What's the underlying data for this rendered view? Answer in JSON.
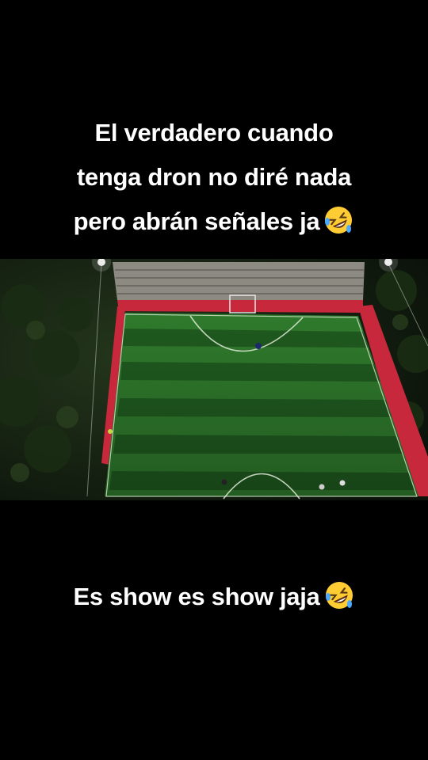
{
  "caption_top": {
    "lines": [
      "El verdadero cuando",
      "tenga dron no diré nada",
      "pero abrán señales ja"
    ],
    "emoji": "rolling-on-floor-laughing-emoji"
  },
  "caption_bottom": {
    "text": "Es show es show jaja",
    "emoji": "rolling-on-floor-laughing-emoji"
  },
  "photo": {
    "subject": "aerial-drone-view-football-field-night",
    "colors": {
      "grass_light": "#2f7a2c",
      "grass_dark": "#1f5a1f",
      "wall_red": "#c8283c",
      "trees": "#1b2a14"
    }
  }
}
